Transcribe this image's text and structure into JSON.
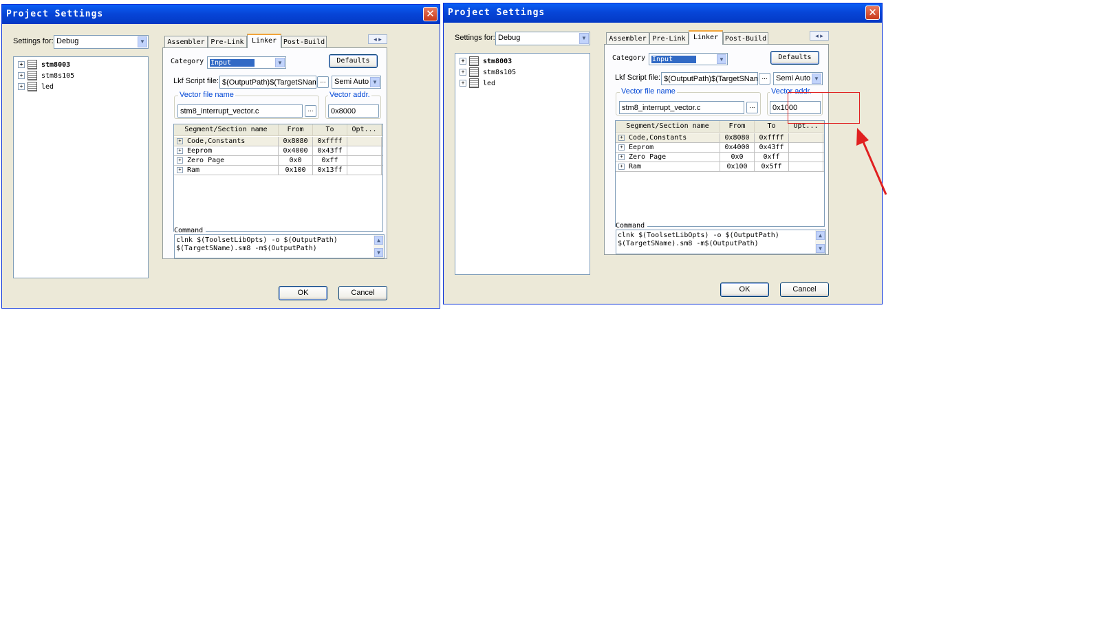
{
  "dialogs": [
    {
      "title": "Project Settings",
      "settings_for_label": "Settings for:",
      "settings_for_value": "Debug",
      "tree": [
        "stm8003",
        "stm8s105",
        "led"
      ],
      "tabs": [
        "Assembler",
        "Pre-Link",
        "Linker",
        "Post-Build"
      ],
      "active_tab": "Linker",
      "category_label": "Category",
      "category_value": "Input",
      "defaults_label": "Defaults",
      "lkf_label": "Lkf Script file:",
      "lkf_value": "$(OutputPath)$(TargetSName",
      "lkf_mode": "Semi Auto",
      "vector_file_label": "Vector file name",
      "vector_file_value": "stm8_interrupt_vector.c",
      "browse_label": "...",
      "vector_addr_label": "Vector addr.",
      "vector_addr_value": "0x8000",
      "columns": [
        "Segment/Section name",
        "From",
        "To",
        "Opt..."
      ],
      "rows": [
        {
          "name": "Code,Constants",
          "from": "0x8080",
          "to": "0xffff",
          "opt": ""
        },
        {
          "name": "Eeprom",
          "from": "0x4000",
          "to": "0x43ff",
          "opt": ""
        },
        {
          "name": "Zero Page",
          "from": "0x0",
          "to": "0xff",
          "opt": ""
        },
        {
          "name": "Ram",
          "from": "0x100",
          "to": "0x13ff",
          "opt": ""
        }
      ],
      "command_label": "Command",
      "command_line1": "clnk $(ToolsetLibOpts) -o $(OutputPath)",
      "command_line2": "$(TargetSName).sm8 -m$(OutputPath)",
      "ok_label": "OK",
      "cancel_label": "Cancel"
    },
    {
      "title": "Project Settings",
      "settings_for_label": "Settings for:",
      "settings_for_value": "Debug",
      "tree": [
        "stm8003",
        "stm8s105",
        "led"
      ],
      "tabs": [
        "Assembler",
        "Pre-Link",
        "Linker",
        "Post-Build"
      ],
      "active_tab": "Linker",
      "category_label": "Category",
      "category_value": "Input",
      "defaults_label": "Defaults",
      "lkf_label": "Lkf Script file:",
      "lkf_value": "$(OutputPath)$(TargetSName",
      "lkf_mode": "Semi Auto",
      "vector_file_label": "Vector file name",
      "vector_file_value": "stm8_interrupt_vector.c",
      "browse_label": "...",
      "vector_addr_label": "Vector addr.",
      "vector_addr_value": "0x1000",
      "columns": [
        "Segment/Section name",
        "From",
        "To",
        "Opt..."
      ],
      "rows": [
        {
          "name": "Code,Constants",
          "from": "0x8080",
          "to": "0xffff",
          "opt": ""
        },
        {
          "name": "Eeprom",
          "from": "0x4000",
          "to": "0x43ff",
          "opt": ""
        },
        {
          "name": "Zero Page",
          "from": "0x0",
          "to": "0xff",
          "opt": ""
        },
        {
          "name": "Ram",
          "from": "0x100",
          "to": "0x5ff",
          "opt": ""
        }
      ],
      "command_label": "Command",
      "command_line1": "clnk $(ToolsetLibOpts) -o $(OutputPath)",
      "command_line2": "$(TargetSName).sm8 -m$(OutputPath)",
      "ok_label": "OK",
      "cancel_label": "Cancel"
    }
  ],
  "annotation": {
    "color": "#e02020",
    "highlight": "vector-addr-box"
  },
  "icons": {
    "close": "close-icon",
    "tree_node": "project-icon",
    "expand": "plus-icon",
    "dropdown": "chevron-down-icon"
  }
}
